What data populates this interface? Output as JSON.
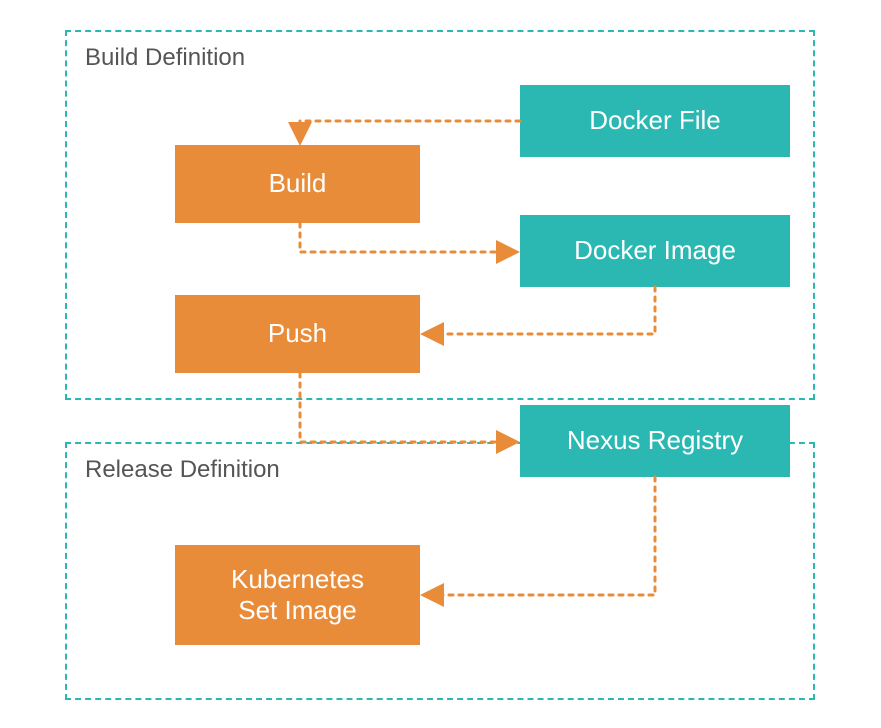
{
  "colors": {
    "teal": "#2BB8B3",
    "orange": "#E98C3A",
    "arrow": "#E98C3A",
    "label": "#555555"
  },
  "groups": {
    "build": {
      "label": "Build Definition"
    },
    "release": {
      "label": "Release Definition"
    }
  },
  "nodes": {
    "dockerfile": {
      "label": "Docker File"
    },
    "build": {
      "label": "Build"
    },
    "dockerimage": {
      "label": "Docker Image"
    },
    "push": {
      "label": "Push"
    },
    "nexus": {
      "label": "Nexus Registry"
    },
    "k8s": {
      "label": "Kubernetes\nSet Image"
    }
  }
}
